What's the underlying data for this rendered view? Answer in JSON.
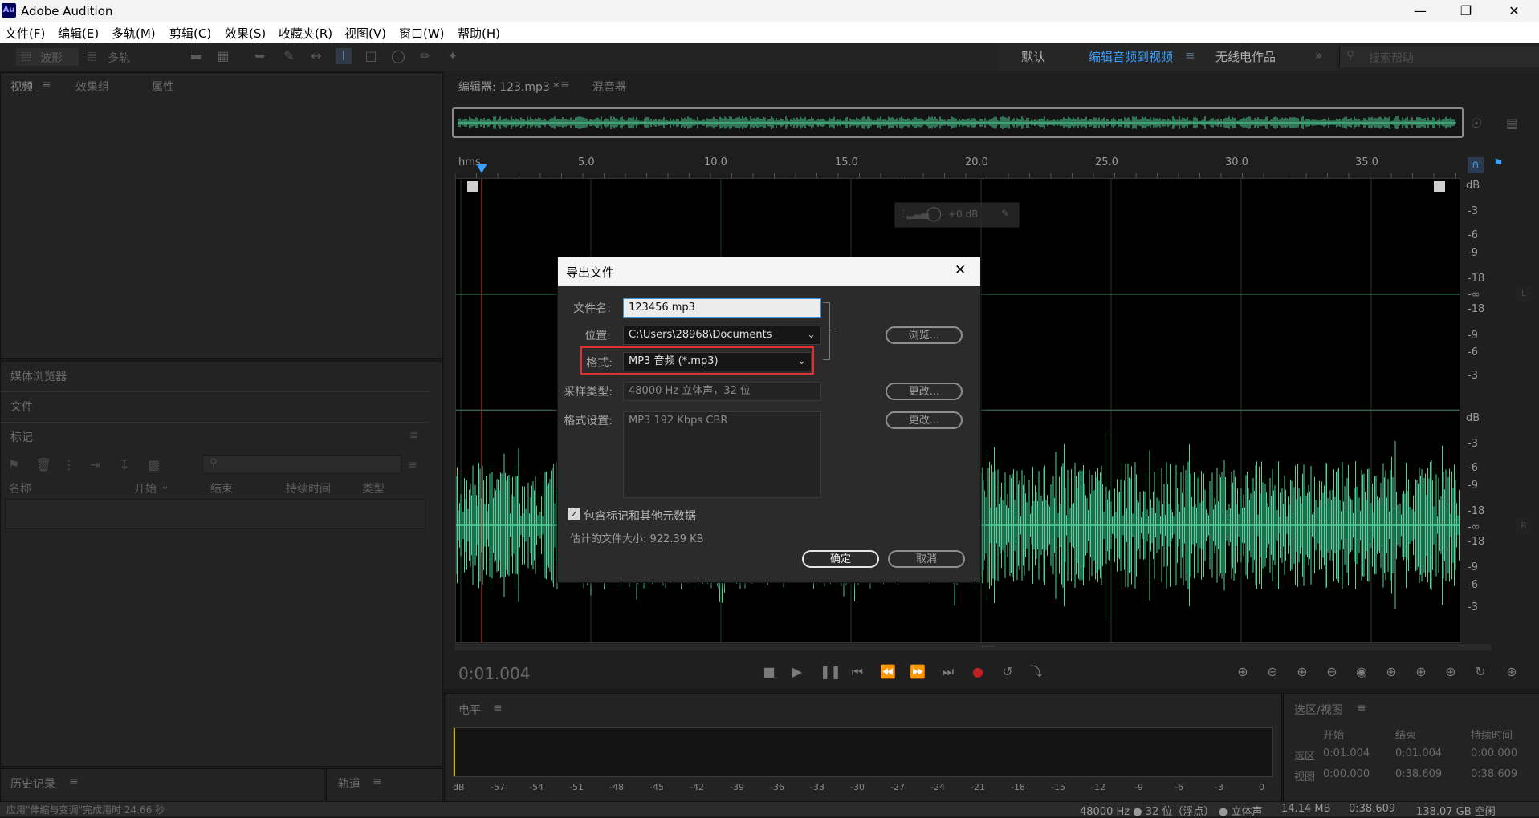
{
  "window": {
    "icon_text": "Au",
    "title": "Adobe Audition"
  },
  "menu": [
    "文件(F)",
    "编辑(E)",
    "多轨(M)",
    "剪辑(C)",
    "效果(S)",
    "收藏夹(R)",
    "视图(V)",
    "窗口(W)",
    "帮助(H)"
  ],
  "toolbar": {
    "mode_waveform": "波形",
    "mode_multitrack": "多轨",
    "workspaces": [
      "默认",
      "编辑音频到视频",
      "无线电作品"
    ],
    "active_workspace": "编辑音频到视频",
    "search_placeholder": "搜索帮助"
  },
  "left_top_panel": {
    "tabs": [
      "视频",
      "效果组",
      "属性"
    ],
    "active": "视频"
  },
  "media_browser": {
    "label": "媒体浏览器"
  },
  "files": {
    "label": "文件"
  },
  "markers": {
    "label": "标记",
    "columns": [
      "名称",
      "开始",
      "结束",
      "持续时间",
      "类型"
    ]
  },
  "history": {
    "label": "历史记录"
  },
  "tracks": {
    "label": "轨道"
  },
  "editor": {
    "tabs": [
      "编辑器: 123.mp3 *",
      "混音器"
    ],
    "ruler_unit": "hms",
    "ruler_ticks": [
      "5.0",
      "10.0",
      "15.0",
      "20.0",
      "25.0",
      "30.0",
      "35.0"
    ],
    "db_left": [
      "dB",
      "-3",
      "-6",
      "-9",
      "-18",
      "-∞",
      "-18",
      "-9",
      "-6",
      "-3"
    ],
    "db_right": [
      "dB",
      "-3",
      "-6",
      "-9",
      "-18",
      "-∞",
      "-18",
      "-9",
      "-6",
      "-3"
    ],
    "channel_left": "L",
    "channel_right": "R",
    "hud_volume": "+0 dB",
    "current_time": "0:01.004",
    "accent": "#3aa0ff",
    "wave_color": "#4fd39a"
  },
  "dialog": {
    "title": "导出文件",
    "filename_label": "文件名:",
    "filename_value": "123456.mp3",
    "location_label": "位置:",
    "location_value": "C:\\Users\\28968\\Documents",
    "browse_label": "浏览...",
    "format_label": "格式:",
    "format_value": "MP3 音频 (*.mp3)",
    "sample_label": "采样类型:",
    "sample_value": "48000 Hz 立体声，32 位",
    "change_label": "更改...",
    "format_settings_label": "格式设置:",
    "format_settings_value": "MP3 192 Kbps CBR",
    "include_markers_label": "包含标记和其他元数据",
    "include_markers_checked": true,
    "estimated_size": "估计的文件大小: 922.39 KB",
    "ok_label": "确定",
    "cancel_label": "取消"
  },
  "levels": {
    "label": "电平",
    "ticks": [
      "dB",
      "-57",
      "-54",
      "-51",
      "-48",
      "-45",
      "-42",
      "-39",
      "-36",
      "-33",
      "-30",
      "-27",
      "-24",
      "-21",
      "-18",
      "-15",
      "-12",
      "-9",
      "-6",
      "-3",
      "0"
    ]
  },
  "selection_view": {
    "label": "选区/视图",
    "columns": [
      "开始",
      "结束",
      "持续时间"
    ],
    "rows": [
      {
        "name": "选区",
        "start": "0:01.004",
        "end": "0:01.004",
        "duration": "0:00.000"
      },
      {
        "name": "视图",
        "start": "0:00.000",
        "end": "0:38.609",
        "duration": "0:38.609"
      }
    ]
  },
  "status": {
    "message": "应用\"伸缩与变调\"完成用时 24.66 秒",
    "sample_info": "48000 Hz ● 32 位（浮点）",
    "channels": "● 立体声",
    "size": "14.14 MB",
    "duration": "0:38.609",
    "free_space": "138.07 GB 空闲"
  }
}
